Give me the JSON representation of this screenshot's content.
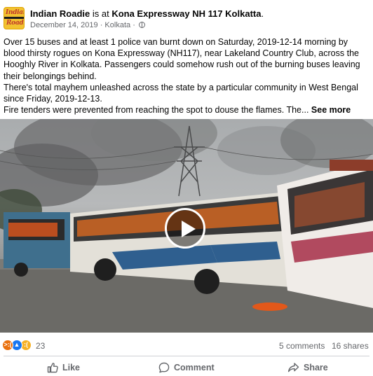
{
  "post": {
    "page_name": "Indian Roadie",
    "connector": " is at ",
    "location": "Kona Expressway NH 117 Kolkatta",
    "period": ".",
    "date": "December 14, 2019",
    "place": "Kolkata",
    "avatar_text_top": "Indian",
    "avatar_text_bottom": "Roadie",
    "text_lines": [
      "Over 15 buses and at least 1 police van burnt down on Saturday, 2019-12-14 morning by blood thirsty rogues on Kona Expressway (NH117), near Lakeland Country Club, across the Hooghly River in Kolkata. Passengers could somehow rush out of the burning buses leaving their belongings behind.",
      "There's total mayhem unleashed across the state by a particular community in West Bengal since Friday, 2019-12-13.",
      "Fire tenders were prevented from reaching the spot to douse the flames. The..."
    ],
    "see_more": "See more"
  },
  "stats": {
    "reaction_count": "23",
    "comments": "5 comments",
    "shares": "16 shares",
    "reactions": [
      "angry",
      "like",
      "sad"
    ]
  },
  "actions": {
    "like": "Like",
    "comment": "Comment",
    "share": "Share"
  },
  "icons": {
    "more": "more-options-icon",
    "globe": "globe-icon",
    "play": "play-icon"
  },
  "colors": {
    "secondary_text": "#65676b",
    "like_blue": "#1877f2",
    "angry_orange": "#e9710f",
    "sad_yellow": "#f7b125"
  }
}
